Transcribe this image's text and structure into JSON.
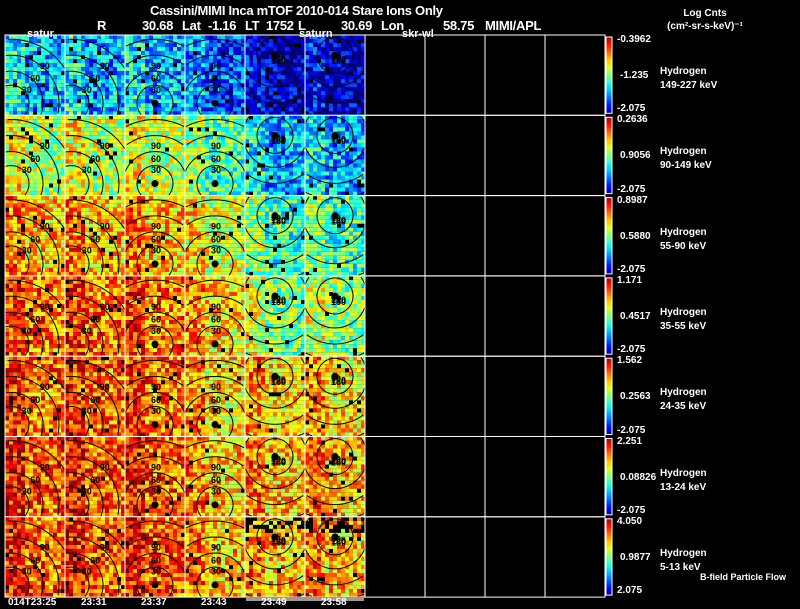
{
  "header": {
    "title": "Cassini/MIMI Inca mTOF  2010-014    Stare    Ions Only",
    "r_label": "R",
    "r_value": "30.68",
    "lat_label": "Lat",
    "lat_value": "-1.16",
    "lt_label": "LT",
    "lt_value": "1752",
    "l_label": "L",
    "l_value": "30.69",
    "lon_label": "Lon",
    "lon_value": "58.75",
    "source": "MIMI/APL"
  },
  "units": {
    "line1": "Log Cnts",
    "line2": "(cm²-sr-s-keV)⁻¹"
  },
  "panel_markers": [
    "satur",
    "saturn",
    "skr-wl"
  ],
  "footer_note": "B-field Particle Flow",
  "chart_data": {
    "type": "heatmap",
    "title": "Cassini/MIMI Inca mTOF  2010-014    Stare    Ions Only",
    "times": [
      "014T23:25",
      "23:31",
      "23:37",
      "23:43",
      "23:49",
      "23:58"
    ],
    "contour_levels": [
      "30",
      "60",
      "90",
      "120",
      "150"
    ],
    "colormap": "rainbow (blue-cyan-yellow-red)",
    "rows": [
      {
        "species": "Hydrogen",
        "energy": "149-227 keV",
        "cmax": "-0.3962",
        "cmid": "-1.235",
        "cmin": "-2.075"
      },
      {
        "species": "Hydrogen",
        "energy": "90-149 keV",
        "cmax": "0.2636",
        "cmid": "0.9056",
        "cmin": "-2.075"
      },
      {
        "species": "Hydrogen",
        "energy": "55-90 keV",
        "cmax": "0.8987",
        "cmid": "0.5880",
        "cmin": "-2.075"
      },
      {
        "species": "Hydrogen",
        "energy": "35-55 keV",
        "cmax": "1.171",
        "cmid": "0.4517",
        "cmin": "-2.075"
      },
      {
        "species": "Hydrogen",
        "energy": "24-35 keV",
        "cmax": "1.562",
        "cmid": "0.2563",
        "cmin": "-2.075"
      },
      {
        "species": "Hydrogen",
        "energy": "13-24 keV",
        "cmax": "2.251",
        "cmid": "0.08826",
        "cmin": "-2.075"
      },
      {
        "species": "Hydrogen",
        "energy": "5-13 keV",
        "cmax": "4.050",
        "cmid": "0.9877",
        "cmin": "2.075"
      }
    ]
  }
}
